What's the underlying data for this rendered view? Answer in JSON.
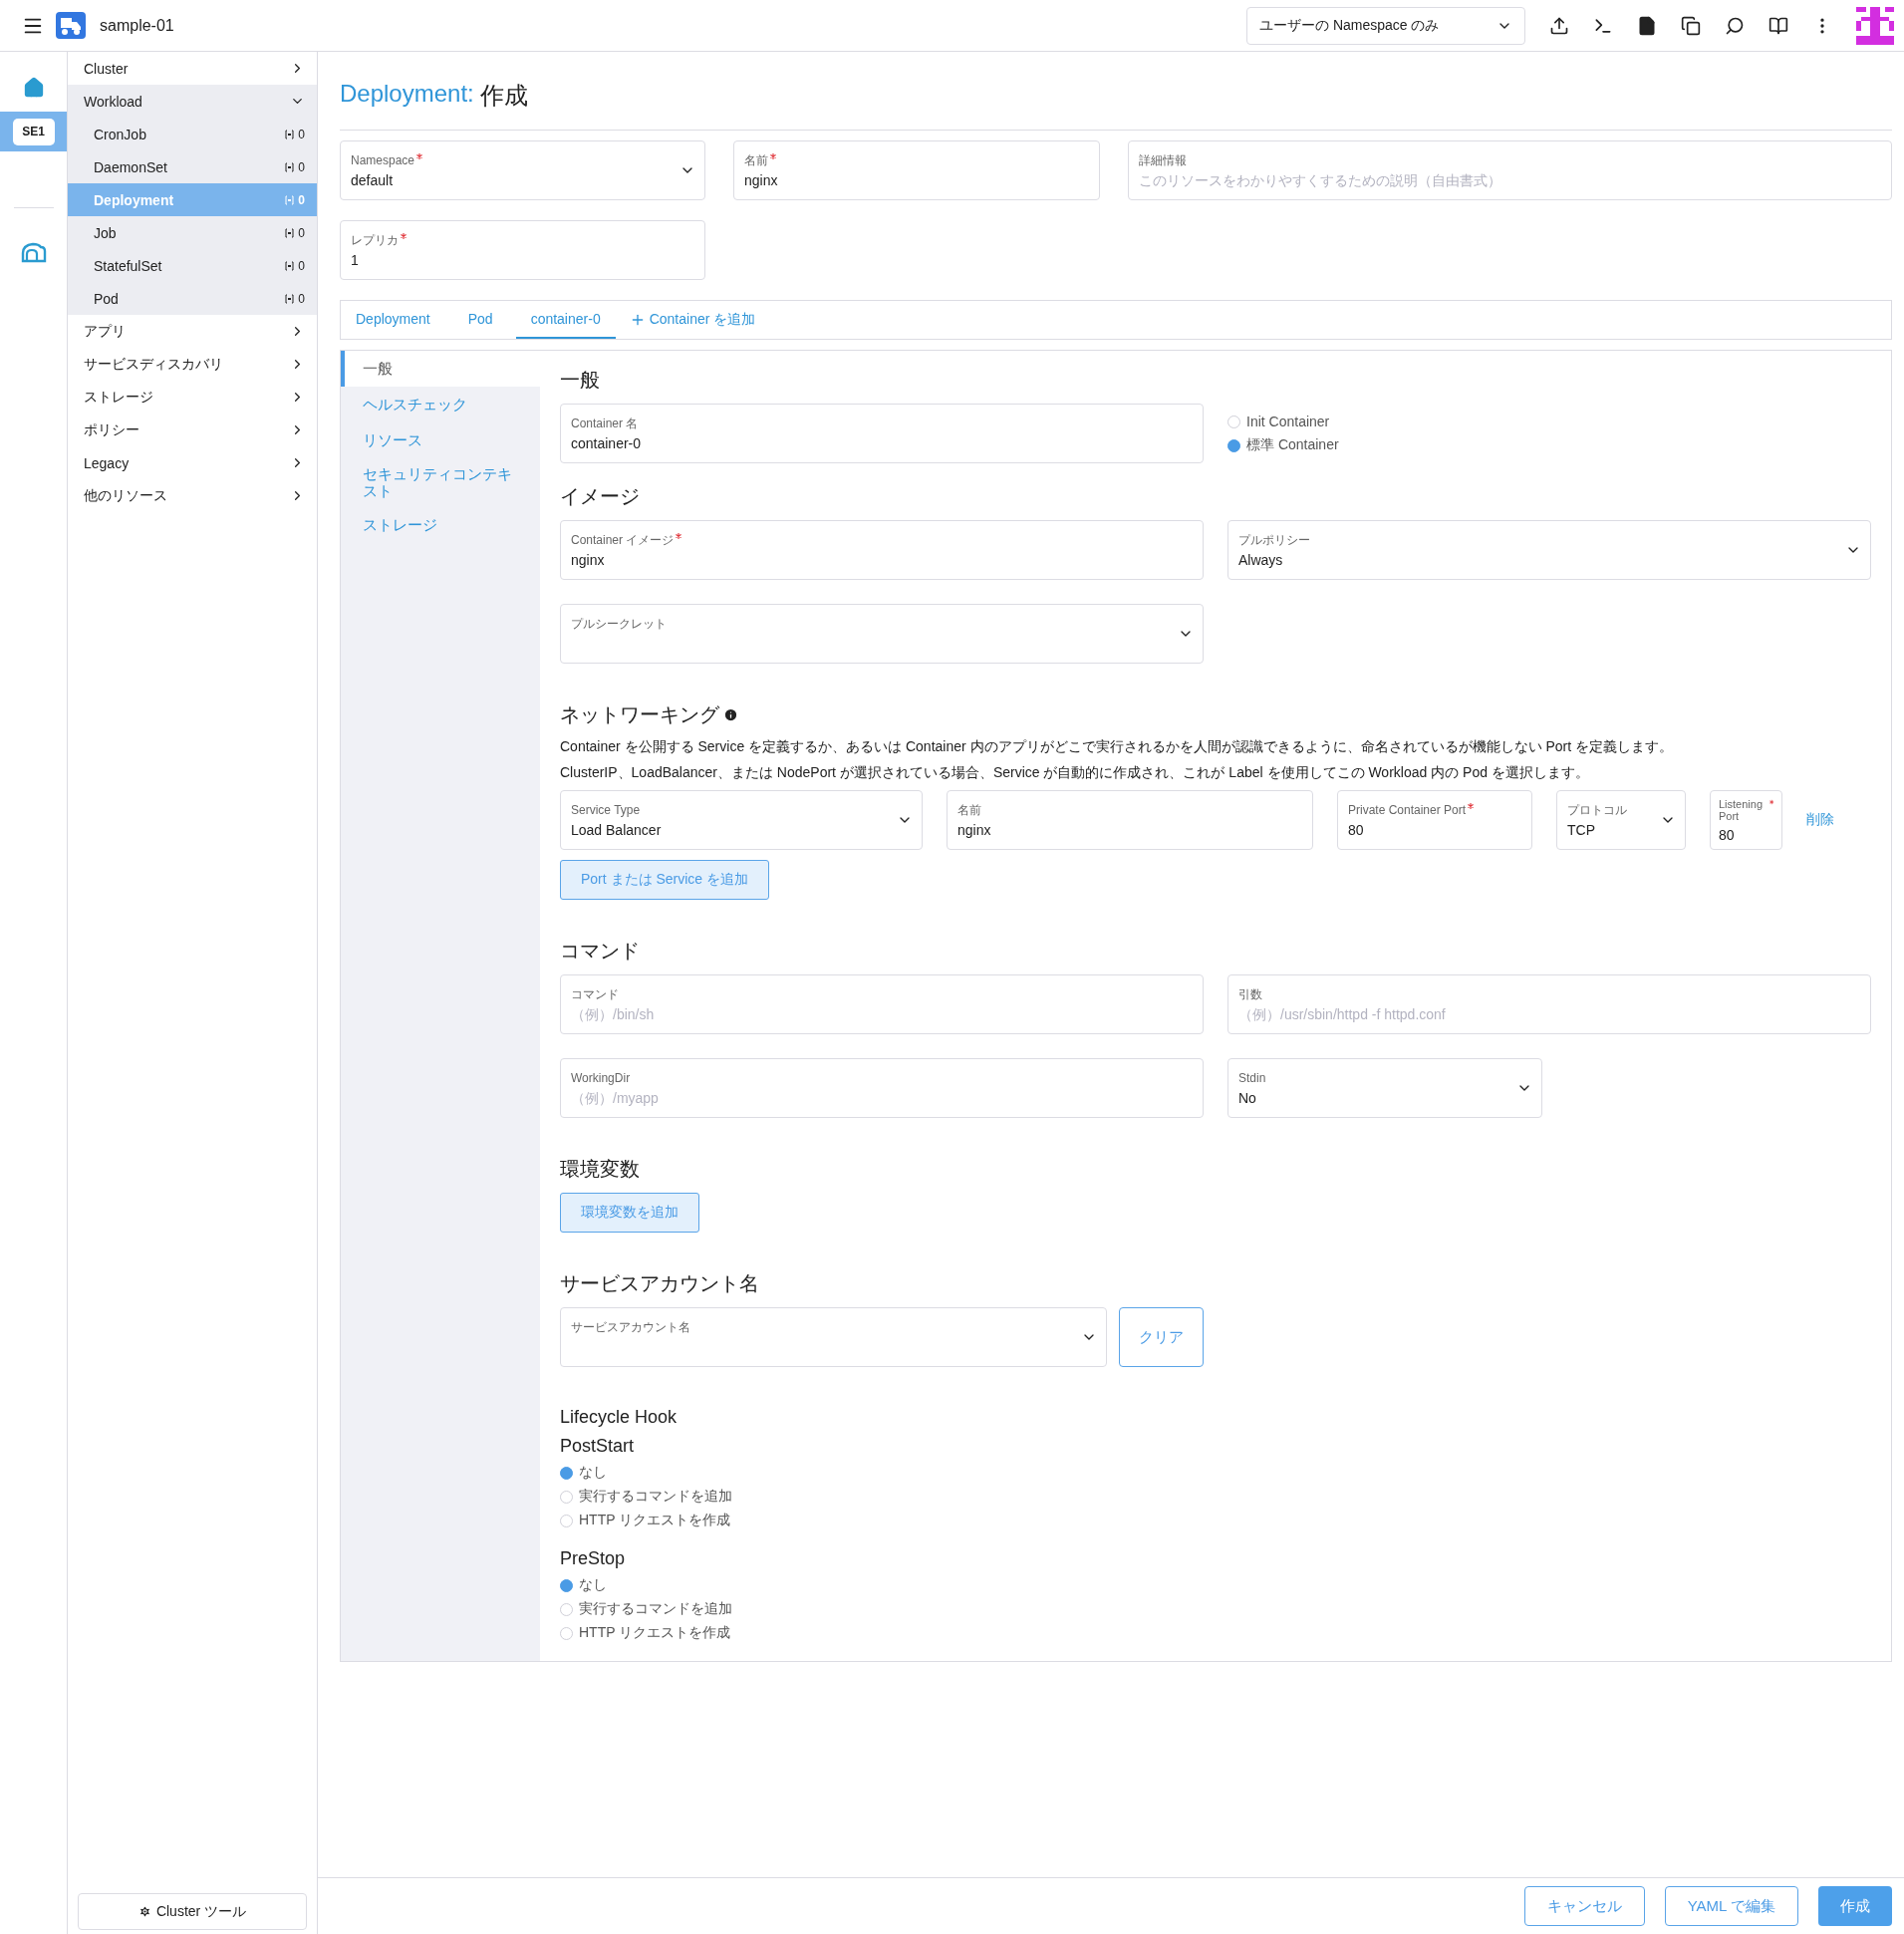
{
  "header": {
    "title": "sample-01",
    "namespace_filter": "ユーザーの Namespace のみ"
  },
  "rail": [
    {
      "kind": "home",
      "selected": false
    },
    {
      "kind": "cluster_badge",
      "label": "SE1",
      "selected": true
    },
    {
      "kind": "explorer",
      "selected": false
    }
  ],
  "sidebar": {
    "items": [
      {
        "label": "Cluster",
        "expanded": false
      },
      {
        "label": "Workload",
        "expanded": true,
        "children": [
          {
            "label": "CronJob",
            "count": "0",
            "selected": false
          },
          {
            "label": "DaemonSet",
            "count": "0",
            "selected": false
          },
          {
            "label": "Deployment",
            "count": "0",
            "selected": true
          },
          {
            "label": "Job",
            "count": "0",
            "selected": false
          },
          {
            "label": "StatefulSet",
            "count": "0",
            "selected": false
          },
          {
            "label": "Pod",
            "count": "0",
            "selected": false
          }
        ]
      },
      {
        "label": "アプリ",
        "expanded": false
      },
      {
        "label": "サービスディスカバリ",
        "expanded": false
      },
      {
        "label": "ストレージ",
        "expanded": false
      },
      {
        "label": "ポリシー",
        "expanded": false
      },
      {
        "label": "Legacy",
        "expanded": false
      },
      {
        "label": "他のリソース",
        "expanded": false
      }
    ],
    "footer_button": "Cluster ツール"
  },
  "page": {
    "title_kind": "Deployment:",
    "title_action": "作成"
  },
  "top_fields": [
    {
      "kind": "select",
      "label": "Namespace",
      "required": true,
      "value": "default"
    },
    {
      "kind": "text",
      "label": "名前",
      "required": true,
      "value": "nginx"
    },
    {
      "kind": "text",
      "label": "詳細情報",
      "required": false,
      "placeholder": "このリソースをわかりやすくするための説明（自由書式）"
    }
  ],
  "replicas": {
    "kind": "text",
    "label": "レプリカ",
    "required": true,
    "value": "1"
  },
  "tabs": [
    {
      "label": "Deployment",
      "selected": false
    },
    {
      "label": "Pod",
      "selected": false
    },
    {
      "label": "container-0",
      "selected": true
    }
  ],
  "add_tab": "Container を追加",
  "container_nav": [
    {
      "label": "一般",
      "selected": true
    },
    {
      "label": "ヘルスチェック",
      "selected": false
    },
    {
      "label": "リソース",
      "selected": false
    },
    {
      "label": "セキュリティコンテキスト",
      "selected": false
    },
    {
      "label": "ストレージ",
      "selected": false
    }
  ],
  "general": {
    "heading": "一般",
    "name_field": {
      "kind": "text",
      "label": "Container 名",
      "required": false,
      "value": "container-0"
    },
    "container_type": [
      {
        "label": "Init Container",
        "selected": false
      },
      {
        "label": "標準 Container",
        "selected": true
      }
    ]
  },
  "image": {
    "heading": "イメージ",
    "fields": [
      {
        "kind": "text",
        "label": "Container イメージ",
        "required": true,
        "value": "nginx"
      },
      {
        "kind": "select",
        "label": "プルポリシー",
        "required": false,
        "value": "Always"
      }
    ],
    "pull_secret": {
      "kind": "select",
      "label": "プルシークレット",
      "required": false
    }
  },
  "networking": {
    "heading": "ネットワーキング",
    "description": [
      "Container を公開する Service を定義するか、あるいは Container 内のアプリがどこで実行されるかを人間が認識できるように、命名されているが機能しない Port を定義します。",
      "ClusterIP、LoadBalancer、または NodePort が選択されている場合、Service が自動的に作成され、これが Label を使用してこの Workload 内の Pod を選択します。"
    ],
    "ports": [
      {
        "fields": [
          {
            "kind": "select",
            "label": "Service Type",
            "required": false,
            "value": "Load Balancer"
          },
          {
            "kind": "text",
            "label": "名前",
            "required": false,
            "value": "nginx"
          },
          {
            "kind": "text",
            "label": "Private Container Port",
            "required": true,
            "value": "80"
          },
          {
            "kind": "select",
            "label": "プロトコル",
            "required": false,
            "value": "TCP"
          },
          {
            "kind": "text",
            "label": "Listening Port",
            "required": true,
            "value": "80"
          }
        ],
        "remove": "削除"
      }
    ],
    "add_button": "Port または Service を追加"
  },
  "command": {
    "heading": "コマンド",
    "fields": [
      {
        "kind": "text",
        "label": "コマンド",
        "required": false,
        "placeholder": "（例）/bin/sh"
      },
      {
        "kind": "text",
        "label": "引数",
        "required": false,
        "placeholder": "（例）/usr/sbin/httpd -f httpd.conf"
      },
      {
        "kind": "text",
        "label": "WorkingDir",
        "required": false,
        "placeholder": "（例）/myapp"
      },
      {
        "kind": "select",
        "label": "Stdin",
        "required": false,
        "value": "No"
      }
    ]
  },
  "env": {
    "heading": "環境変数",
    "add_button": "環境変数を追加"
  },
  "service_account": {
    "heading": "サービスアカウント名",
    "field": {
      "kind": "select",
      "label": "サービスアカウント名",
      "required": false
    },
    "clear_button": "クリア"
  },
  "lifecycle": {
    "heading": "Lifecycle Hook",
    "hooks": [
      {
        "name": "PostStart",
        "options": [
          {
            "label": "なし",
            "selected": true
          },
          {
            "label": "実行するコマンドを追加",
            "selected": false
          },
          {
            "label": "HTTP リクエストを作成",
            "selected": false
          }
        ]
      },
      {
        "name": "PreStop",
        "options": [
          {
            "label": "なし",
            "selected": true
          },
          {
            "label": "実行するコマンドを追加",
            "selected": false
          },
          {
            "label": "HTTP リクエストを作成",
            "selected": false
          }
        ]
      }
    ]
  },
  "footer": {
    "buttons": [
      {
        "label": "キャンセル",
        "kind": "secondary"
      },
      {
        "label": "YAML で編集",
        "kind": "secondary"
      },
      {
        "label": "作成",
        "kind": "primary"
      }
    ]
  }
}
